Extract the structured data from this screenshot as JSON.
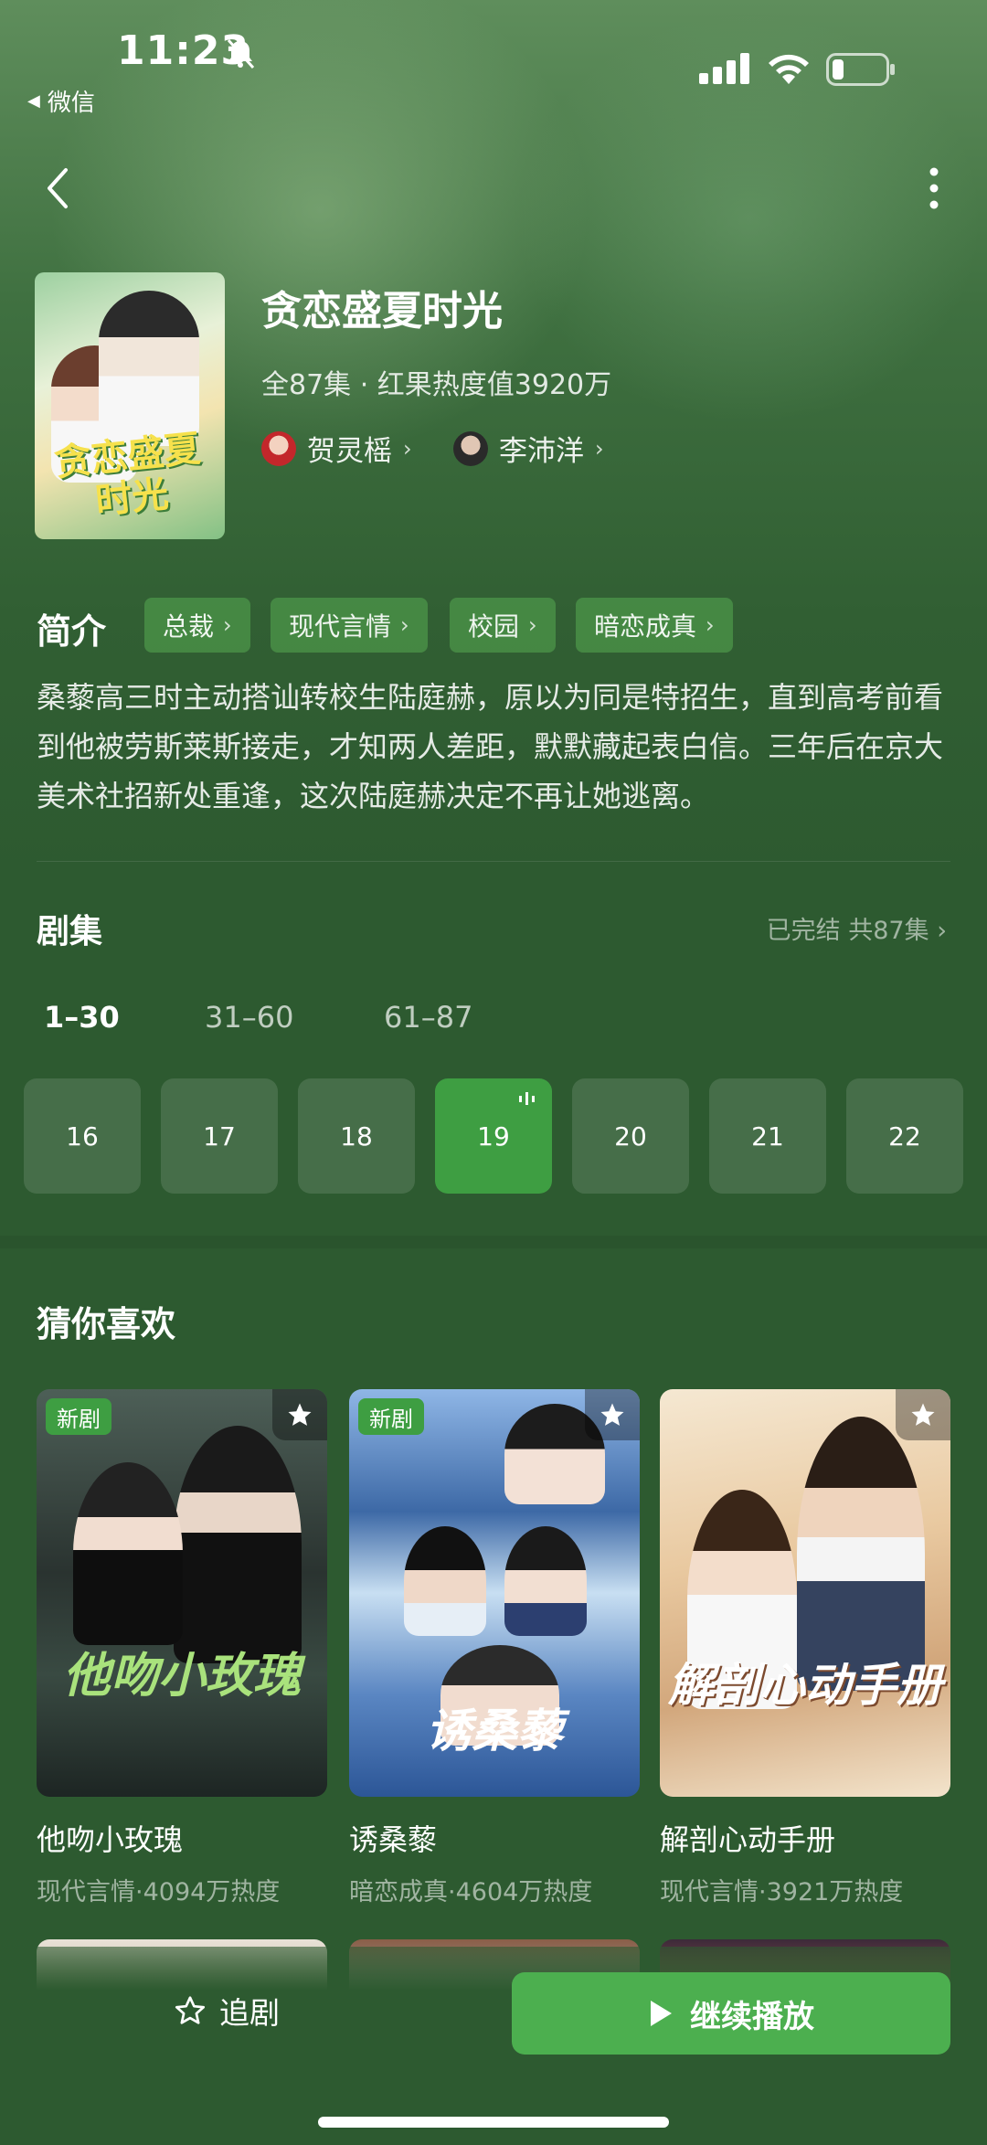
{
  "status_bar": {
    "time": "11:23",
    "back_app": "微信"
  },
  "drama": {
    "title": "贪恋盛夏时光",
    "meta": "全87集 · 红果热度值3920万",
    "poster_title": "贪恋盛夏时光",
    "actors": [
      {
        "name": "贺灵榣"
      },
      {
        "name": "李沛洋"
      }
    ]
  },
  "intro": {
    "heading": "简介",
    "tags": [
      "总裁",
      "现代言情",
      "校园",
      "暗恋成真"
    ],
    "text": "桑藜高三时主动搭讪转校生陆庭赫，原以为同是特招生，直到高考前看到他被劳斯莱斯接走，才知两人差距，默默藏起表白信。三年后在京大美术社招新处重逢，这次陆庭赫决定不再让她逃离。"
  },
  "episodes": {
    "heading": "剧集",
    "status": "已完结 共87集",
    "ranges": [
      "1–30",
      "31–60",
      "61–87"
    ],
    "active_range": 0,
    "list": [
      "16",
      "17",
      "18",
      "19",
      "20",
      "21",
      "22"
    ],
    "current": "19"
  },
  "recommend": {
    "heading": "猜你喜欢",
    "badge_new": "新剧",
    "items": [
      {
        "title": "他吻小玫瑰",
        "meta": "现代言情·4094万热度",
        "cover_text": "他吻小玫瑰",
        "is_new": true
      },
      {
        "title": "诱桑藜",
        "meta": "暗恋成真·4604万热度",
        "cover_text": "诱桑藜",
        "is_new": true
      },
      {
        "title": "解剖心动手册",
        "meta": "现代言情·3921万热度",
        "cover_text": "解剖心动手册",
        "is_new": false
      }
    ]
  },
  "bottom": {
    "follow_label": "追剧",
    "play_label": "继续播放"
  },
  "colors": {
    "accent": "#4caf4f",
    "background": "#2d5a30"
  }
}
